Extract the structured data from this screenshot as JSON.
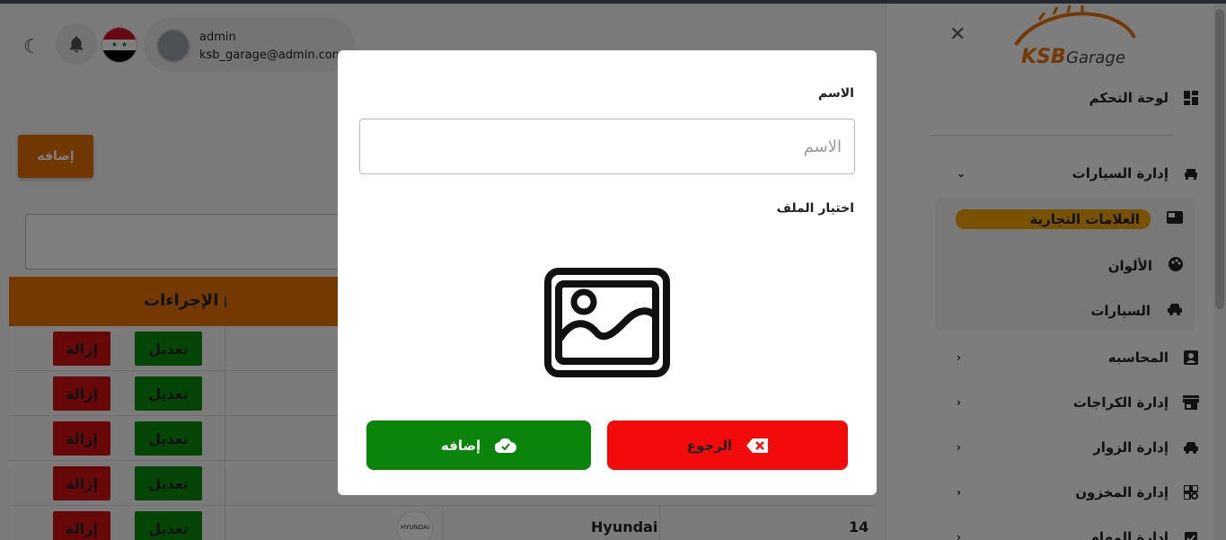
{
  "header": {
    "user_name": "admin",
    "user_email": "ksb_garage@admin.com"
  },
  "sidebar": {
    "logo_text": "KSB Garage",
    "items": [
      {
        "label": "لوحة التحكم",
        "icon": "dashboard-icon"
      },
      {
        "label": "إدارة السيارات",
        "icon": "car-service-icon",
        "expanded": true
      },
      {
        "label": "المحاسبه",
        "icon": "account-box-icon"
      },
      {
        "label": "إدارة الكراجات",
        "icon": "store-icon"
      },
      {
        "label": "إدارة الزوار",
        "icon": "car-icon"
      },
      {
        "label": "إدارة المخزون",
        "icon": "inventory-icon"
      },
      {
        "label": "إدارة المهام",
        "icon": "task-icon"
      }
    ],
    "subitems": [
      {
        "label": "العلامات التجارية",
        "icon": "brand-icon",
        "active": true
      },
      {
        "label": "الألوان",
        "icon": "palette-icon"
      },
      {
        "label": "السيارات",
        "icon": "car-icon"
      }
    ]
  },
  "main": {
    "add_label": "إضافه",
    "table": {
      "actions_header": "الإجراءات",
      "edit_label": "تعديل",
      "delete_label": "إزالة",
      "last_row": {
        "id": "14",
        "brand": "Hyundai",
        "logo_text": "HYUNDAI"
      }
    }
  },
  "modal": {
    "name_label": "الاسم",
    "name_placeholder": "الاسم",
    "name_value": "",
    "file_label": "اختيار الملف",
    "back_label": "الرجوع",
    "submit_label": "إضافه"
  },
  "colors": {
    "accent_orange": "#e67300",
    "active_yellow": "#f0a500",
    "edit_green": "#0a8a0a",
    "delete_red": "#d01010",
    "back_red": "#f30b0b",
    "submit_green": "#0a840a"
  }
}
